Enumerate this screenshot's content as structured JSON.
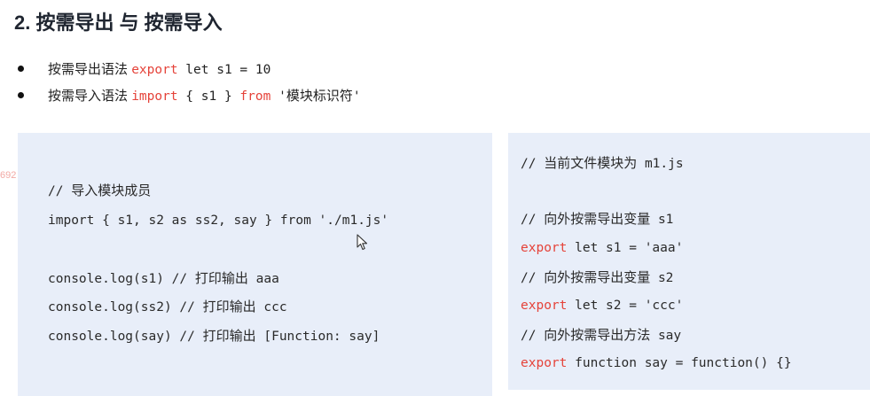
{
  "title": "2.  按需导出 与 按需导入",
  "bullets": [
    {
      "label": "按需导出语法",
      "code_kw": "export",
      "code_rest": " let s1 = 10"
    },
    {
      "label": "按需导入语法",
      "code_kw": "import",
      "code_mid": " { s1 } ",
      "code_kw2": "from",
      "code_rest": " '",
      "code_cn": "模块标识符",
      "code_end": "'"
    }
  ],
  "side_number": "692",
  "left_code": {
    "comment1_prefix": "// ",
    "comment1_cn": "导入模块成员",
    "import_line": "import { s1, s2 as ss2, say } from './m1.js'",
    "log1_code": "console.log(s1) // ",
    "log1_cn": "打印输出",
    "log1_val": " aaa",
    "log2_code": "console.log(ss2) // ",
    "log2_cn": "打印输出",
    "log2_val": " ccc",
    "log3_code": "console.log(say) // ",
    "log3_cn": "打印输出",
    "log3_val": " [Function: say]"
  },
  "right_code": {
    "c1_prefix": "// ",
    "c1_cn": "当前文件模块为",
    "c1_val": " m1.js",
    "c2_prefix": "// ",
    "c2_cn": "向外按需导出变量",
    "c2_val": " s1",
    "e1_kw": "export",
    "e1_rest": " let s1 = 'aaa'",
    "c3_prefix": "// ",
    "c3_cn": "向外按需导出变量",
    "c3_val": " s2",
    "e2_kw": "export",
    "e2_rest": " let s2 = 'ccc'",
    "c4_prefix": "// ",
    "c4_cn": "向外按需导出方法",
    "c4_val": " say",
    "e3_kw": "export",
    "e3_rest": " function say = function() {}"
  },
  "colors": {
    "keyword": "#e5433a",
    "panel_bg": "#e8eef9",
    "text": "#2a2a2a"
  },
  "icons": {
    "cursor": "mouse-pointer-icon",
    "bullet": "bullet-dot-icon"
  }
}
